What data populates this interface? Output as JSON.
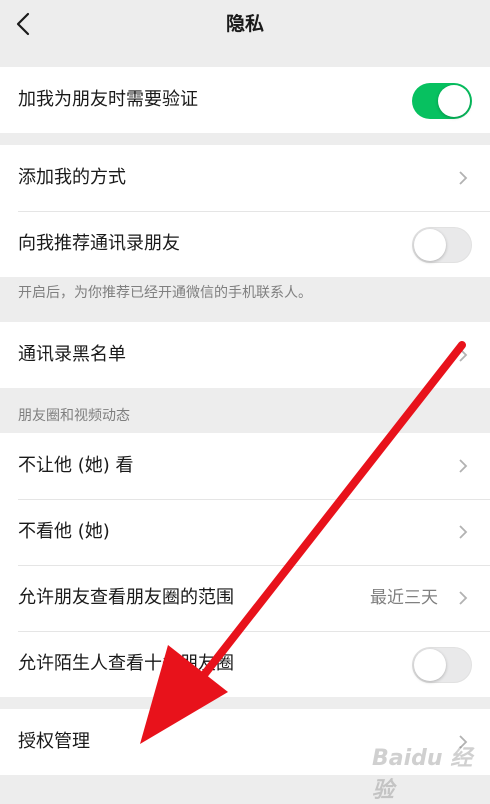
{
  "header": {
    "title": "隐私"
  },
  "sections": {
    "verify": {
      "label": "加我为朋友时需要验证",
      "toggle": "on"
    },
    "add_method": {
      "label": "添加我的方式"
    },
    "recommend": {
      "label": "向我推荐通讯录朋友",
      "toggle": "off"
    },
    "recommend_note": "开启后，为你推荐已经开通微信的手机联系人。",
    "blacklist": {
      "label": "通讯录黑名单"
    },
    "moments_header": "朋友圈和视频动态",
    "dont_let_see": {
      "label": "不让他 (她) 看"
    },
    "dont_see": {
      "label": "不看他 (她)"
    },
    "moments_range": {
      "label": "允许朋友查看朋友圈的范围",
      "value": "最近三天"
    },
    "stranger_view": {
      "label": "允许陌生人查看十条朋友圈",
      "toggle": "off"
    },
    "authorization": {
      "label": "授权管理"
    }
  },
  "colors": {
    "accent": "#07c160",
    "arrow": "#e8121b"
  },
  "watermark": "Baidu 经验"
}
